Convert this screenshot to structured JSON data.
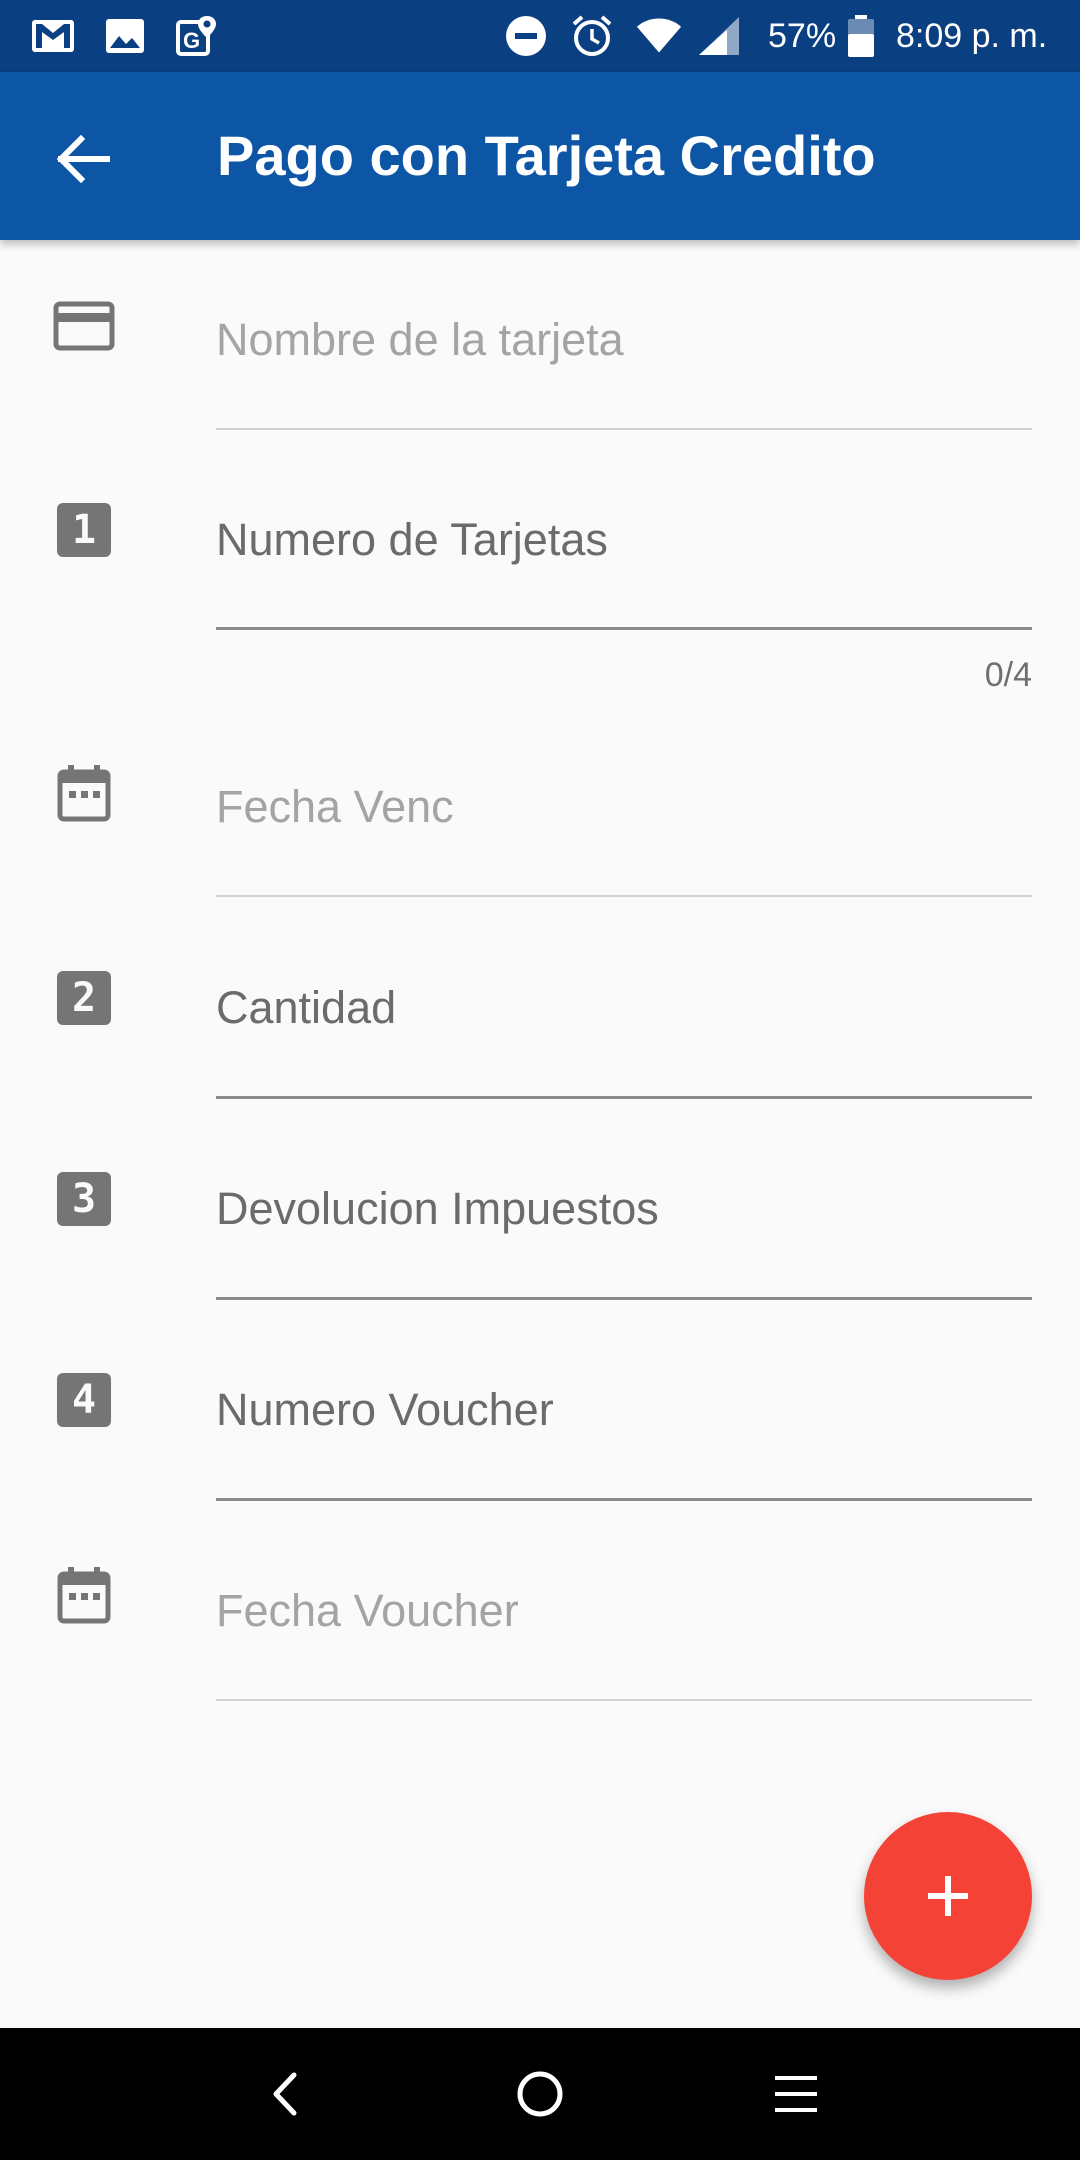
{
  "status_bar": {
    "battery_percent": "57%",
    "time": "8:09 p. m.",
    "icons": [
      "gmail-icon",
      "gallery-icon",
      "maps-icon",
      "do-not-disturb-icon",
      "alarm-icon",
      "wifi-icon",
      "signal-icon",
      "battery-icon"
    ]
  },
  "app_bar": {
    "title": "Pago con Tarjeta Credito",
    "back_icon": "arrow-back-icon",
    "color": "#0d56a6"
  },
  "form": {
    "fields": [
      {
        "icon": "credit-card-icon",
        "placeholder": "Nombre de la tarjeta",
        "value": ""
      },
      {
        "icon": "number-1-icon",
        "badge": "1",
        "placeholder": "Numero de Tarjetas",
        "value": "",
        "counter": "0/4"
      },
      {
        "icon": "calendar-icon",
        "placeholder": "Fecha Venc",
        "value": ""
      },
      {
        "icon": "number-2-icon",
        "badge": "2",
        "placeholder": "Cantidad",
        "value": ""
      },
      {
        "icon": "number-3-icon",
        "badge": "3",
        "placeholder": "Devolucion Impuestos",
        "value": ""
      },
      {
        "icon": "number-4-icon",
        "badge": "4",
        "placeholder": "Numero Voucher",
        "value": ""
      },
      {
        "icon": "calendar-icon",
        "placeholder": "Fecha Voucher",
        "value": ""
      }
    ]
  },
  "fab": {
    "icon": "plus-icon",
    "color": "#f44336"
  },
  "nav_bar": {
    "icons": [
      "nav-back-icon",
      "nav-home-icon",
      "nav-menu-icon"
    ]
  }
}
